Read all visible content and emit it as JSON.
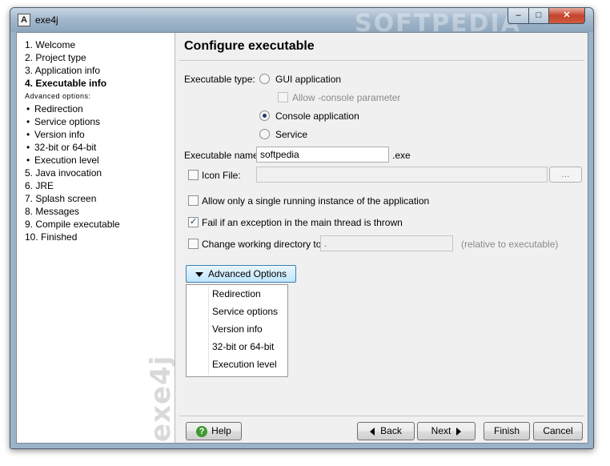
{
  "window": {
    "title": "exe4j",
    "watermark": "SOFTPEDIA",
    "controls": {
      "minimize": "–",
      "maximize": "□",
      "close": "✕"
    }
  },
  "sidebar": {
    "steps": [
      {
        "label": "1. Welcome"
      },
      {
        "label": "2. Project type"
      },
      {
        "label": "3. Application info"
      },
      {
        "label": "4. Executable info",
        "current": true
      }
    ],
    "advanced_header": "Advanced options:",
    "substeps": [
      "Redirection",
      "Service options",
      "Version info",
      "32-bit or 64-bit",
      "Execution level"
    ],
    "later_steps": [
      "5. Java invocation",
      "6. JRE",
      "7. Splash screen",
      "8. Messages",
      "9. Compile executable",
      "10. Finished"
    ],
    "logo_text": "exe4j"
  },
  "main": {
    "heading": "Configure executable",
    "executable_type_label": "Executable type:",
    "types": {
      "gui": "GUI application",
      "allow_console": "Allow -console parameter",
      "console": "Console application",
      "service": "Service"
    },
    "selected_type": "Console application",
    "executable_name_label": "Executable name:",
    "executable_name_value": "softpedia",
    "exe_suffix": ".exe",
    "icon_file_label": "Icon File:",
    "icon_file_value": "",
    "browse_label": "...",
    "single_instance_label": "Allow only a single running instance of the application",
    "single_instance_checked": false,
    "fail_exception_label": "Fail if an exception in the main thread is thrown",
    "fail_exception_checked": true,
    "change_dir_label": "Change working directory to:",
    "change_dir_value": ".",
    "change_dir_hint": "(relative to executable)",
    "change_dir_checked": false,
    "advanced_button": "Advanced Options",
    "advanced_menu": [
      "Redirection",
      "Service options",
      "Version info",
      "32-bit or 64-bit",
      "Execution level"
    ]
  },
  "footer": {
    "help": "Help",
    "back": "Back",
    "next": "Next",
    "finish": "Finish",
    "cancel": "Cancel"
  },
  "colors": {
    "titlebar": "#a4b8cc",
    "close_button": "#c4432b",
    "advanced_button": "#bee6fd"
  }
}
